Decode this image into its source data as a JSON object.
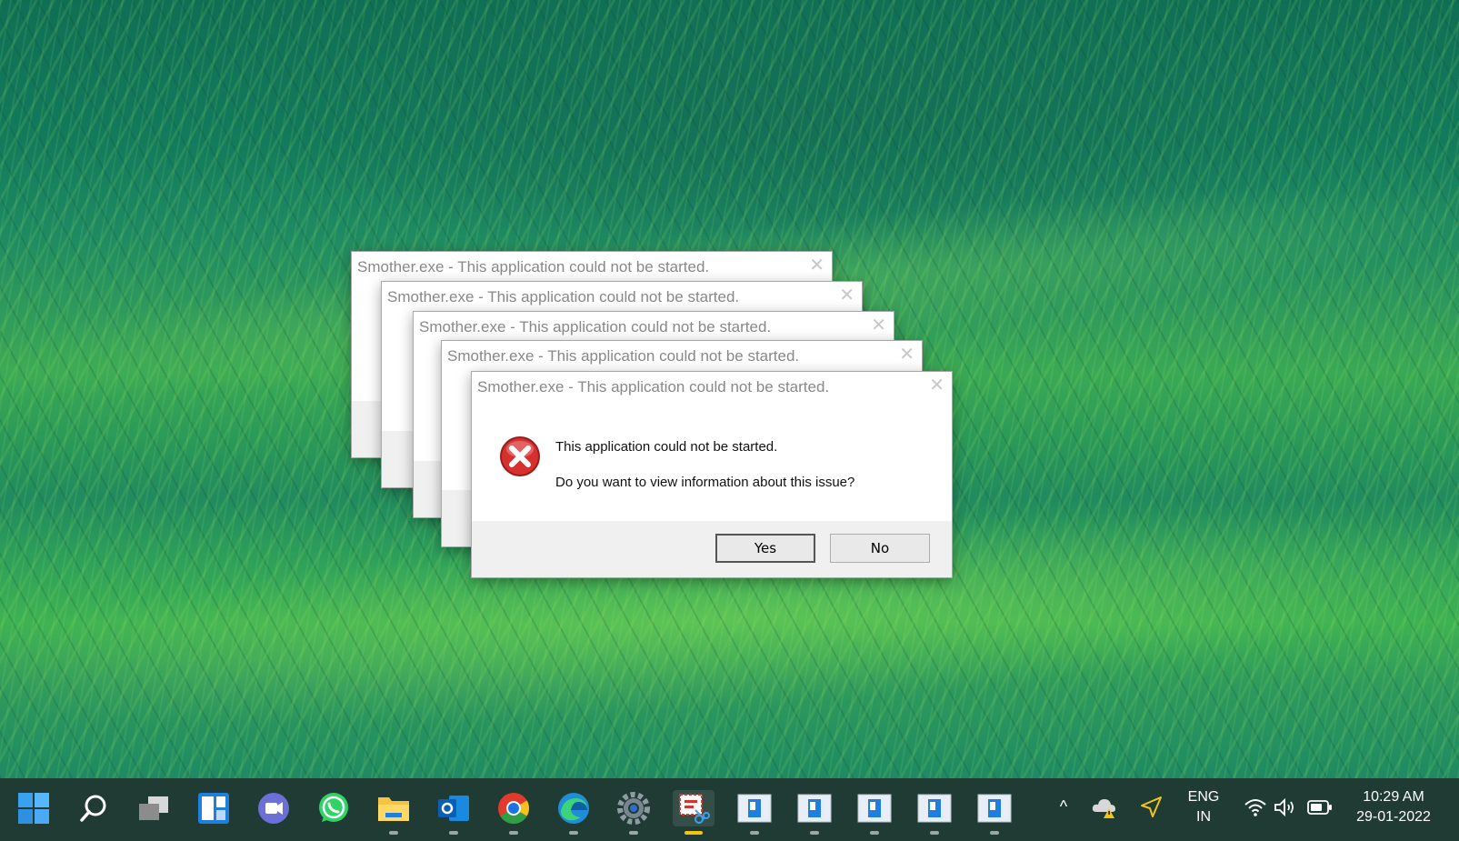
{
  "dialogs": [
    {
      "title": "Smother.exe - This application could not be started.",
      "close": "✕"
    },
    {
      "title": "Smother.exe - This application could not be started.",
      "close": "✕"
    },
    {
      "title": "Smother.exe - This application could not be started.",
      "close": "✕"
    },
    {
      "title": "Smother.exe - This application could not be started.",
      "close": "✕"
    },
    {
      "title": "Smother.exe - This application could not be started.",
      "close": "✕",
      "message": "This application could not be started.",
      "question": "Do you want to view information about this issue?",
      "yes_label": "Yes",
      "no_label": "No",
      "icon": "error-icon"
    }
  ],
  "taskbar": {
    "apps": [
      "start",
      "search",
      "task-view",
      "widgets",
      "teams-chat",
      "whatsapp",
      "file-explorer",
      "outlook",
      "chrome",
      "edge",
      "settings",
      "snipping-tool",
      "app-window-1",
      "app-window-2",
      "app-window-3",
      "app-window-4",
      "app-window-5"
    ],
    "tray": {
      "overflow": "^",
      "language": "ENG",
      "region": "IN",
      "time": "10:29 AM",
      "date": "29-01-2022"
    }
  },
  "colors": {
    "taskbar_bg": "#1f3b34",
    "error_red": "#c8262a",
    "active_indicator": "#f0c419"
  }
}
